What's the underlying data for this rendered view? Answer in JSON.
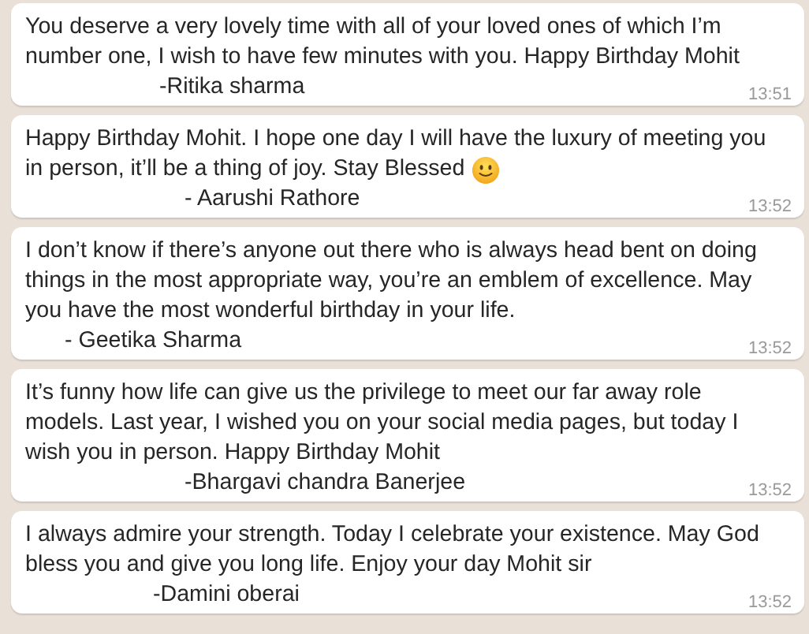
{
  "messages": [
    {
      "text": "You deserve a very lovely time with all of your loved ones of which I’m\nnumber one, I wish to have few minutes with you. Happy Birthday Mohit",
      "emoji": false,
      "signature": "-Ritika sharma",
      "time": "13:51"
    },
    {
      "text": "Happy Birthday Mohit. I hope one day I will have the luxury of meeting you\nin person, it’ll be a thing of joy. Stay Blessed",
      "emoji": true,
      "signature": "- Aarushi Rathore",
      "time": "13:52"
    },
    {
      "text": "I don’t know if there’s anyone out there who is always head bent on doing\nthings in the most appropriate way, you’re an emblem of excellence. May\nyou have the most wonderful birthday in your life.",
      "emoji": false,
      "signature": "- Geetika Sharma",
      "time": "13:52"
    },
    {
      "text": "It’s funny how life can give us the privilege to meet our far away role\nmodels. Last year, I wished you on your social media pages, but today I\nwish you in person. Happy Birthday Mohit",
      "emoji": false,
      "signature": "-Bhargavi chandra Banerjee",
      "time": "13:52"
    },
    {
      "text": "I always admire your strength. Today I celebrate your existence. May God\nbless you and give you long life. Enjoy your day Mohit sir",
      "emoji": false,
      "signature": "-Damini oberai",
      "time": "13:52"
    }
  ]
}
